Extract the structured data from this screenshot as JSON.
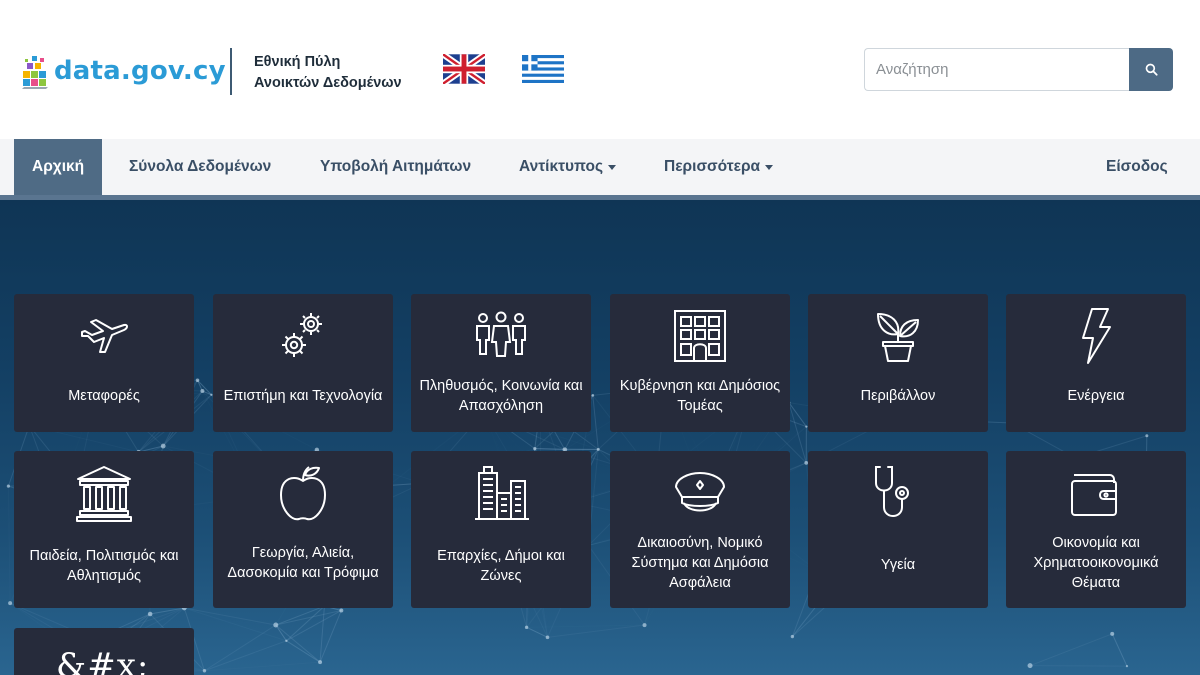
{
  "header": {
    "logo_text": "data.gov.cy",
    "portal_title_line1": "Εθνική Πύλη",
    "portal_title_line2": "Ανοικτών Δεδομένων",
    "search_placeholder": "Αναζήτηση"
  },
  "nav": {
    "items": [
      {
        "label": "Αρχική",
        "active": true
      },
      {
        "label": "Σύνολα Δεδομένων"
      },
      {
        "label": "Υποβολή Αιτημάτων"
      },
      {
        "label": "Αντίκτυπος",
        "dropdown": true
      },
      {
        "label": "Περισσότερα",
        "dropdown": true
      }
    ],
    "login_label": "Είσοδος"
  },
  "categories": [
    {
      "label": "Μεταφορές",
      "icon": "airplane-icon"
    },
    {
      "label": "Επιστήμη και Τεχνολογία",
      "icon": "gears-icon"
    },
    {
      "label": "Πληθυσμός, Κοινωνία και Απασχόληση",
      "icon": "people-icon"
    },
    {
      "label": "Κυβέρνηση και Δημόσιος Τομέας",
      "icon": "building-icon"
    },
    {
      "label": "Περιβάλλον",
      "icon": "plant-icon"
    },
    {
      "label": "Ενέργεια",
      "icon": "lightning-icon"
    },
    {
      "label": "Παιδεία, Πολιτισμός και Αθλητισμός",
      "icon": "museum-icon"
    },
    {
      "label": "Γεωργία, Αλιεία, Δασοκομία και Τρόφιμα",
      "icon": "apple-icon"
    },
    {
      "label": "Επαρχίες, Δήμοι και Ζώνες",
      "icon": "city-icon"
    },
    {
      "label": "Δικαιοσύνη, Νομικό Σύστημα και Δημόσια Ασφάλεια",
      "icon": "police-cap-icon"
    },
    {
      "label": "Υγεία",
      "icon": "stethoscope-icon"
    },
    {
      "label": "Οικονομία και Χρηματοοικονομικά Θέματα",
      "icon": "wallet-icon"
    }
  ],
  "partial_tile_text": "&#x;",
  "colors": {
    "logo_blue": "#2b9bd6",
    "nav_active": "#4f6b85",
    "search_button": "#4d6a85",
    "tile_bg": "#262b3b",
    "hero_top": "#0f3555"
  }
}
